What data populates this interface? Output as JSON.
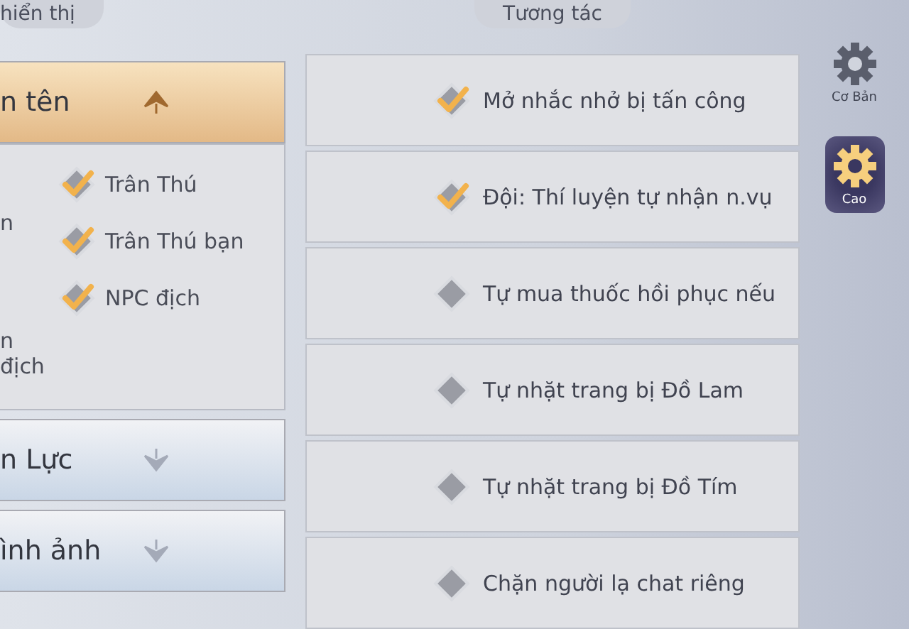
{
  "left_panel": {
    "title": "hiển thị",
    "sections": [
      {
        "label": "n tên",
        "expanded": true,
        "left_items": [
          {
            "label": "n"
          },
          {
            "label": "n địch"
          }
        ],
        "options": [
          {
            "label": "Trân Thú",
            "checked": true
          },
          {
            "label": "Trân Thú bạn",
            "checked": true
          },
          {
            "label": "NPC địch",
            "checked": true
          }
        ]
      },
      {
        "label": "n Lực",
        "expanded": false
      },
      {
        "label": "ình ảnh",
        "expanded": false
      }
    ]
  },
  "right_panel": {
    "title": "Tương tác",
    "options": [
      {
        "label": "Mở nhắc nhở bị tấn công",
        "checked": true
      },
      {
        "label": "Đội: Thí luyện tự nhận n.vụ",
        "checked": true
      },
      {
        "label": "Tự mua thuốc hồi phục nếu",
        "checked": false
      },
      {
        "label": "Tự nhặt trang bị Đồ Lam",
        "checked": false
      },
      {
        "label": "Tự nhặt trang bị Đồ Tím",
        "checked": false
      },
      {
        "label": "Chặn người lạ chat riêng",
        "checked": false
      }
    ]
  },
  "side_tabs": [
    {
      "label": "Cơ Bản",
      "selected": false
    },
    {
      "label": "Cao",
      "selected": true
    }
  ]
}
